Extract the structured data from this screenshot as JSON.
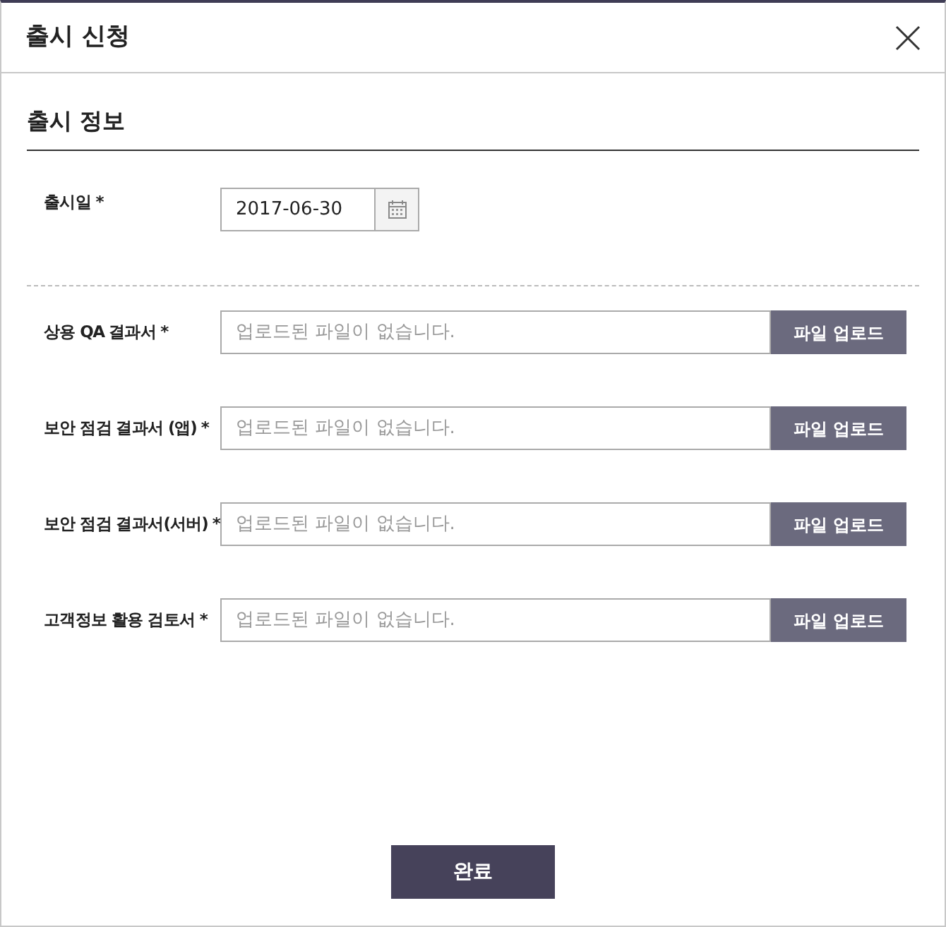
{
  "dialog": {
    "title": "출시 신청"
  },
  "section": {
    "title": "출시 정보"
  },
  "date_field": {
    "label": "출시일 *",
    "value": "2017-06-30"
  },
  "uploads": [
    {
      "label": "상용 QA 결과서 *",
      "placeholder": "업로드된 파일이 없습니다.",
      "button": "파일 업로드"
    },
    {
      "label": "보안 점검 결과서 (앱) *",
      "placeholder": "업로드된 파일이 없습니다.",
      "button": "파일 업로드"
    },
    {
      "label": "보안 점검 결과서(서버) *",
      "placeholder": "업로드된 파일이 없습니다.",
      "button": "파일 업로드"
    },
    {
      "label": "고객정보 활용 검토서 *",
      "placeholder": "업로드된 파일이 없습니다.",
      "button": "파일 업로드"
    }
  ],
  "submit": {
    "label": "완료"
  }
}
